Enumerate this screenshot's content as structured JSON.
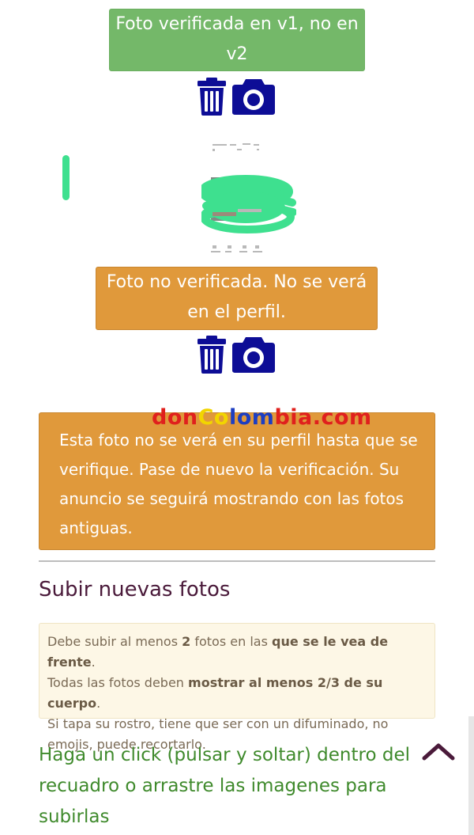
{
  "photo1": {
    "status_text": "Foto verificada en v1, no en v2"
  },
  "photo2": {
    "status_text": "Foto no verificada. No se verá en el perfil."
  },
  "watermark": {
    "part1": "don",
    "part2": "Co",
    "part3": "lom",
    "part4": "bia.com"
  },
  "alert": {
    "text": "Esta foto no se verá en su perfil hasta que se verifique. Pase de nuevo la verificación. Su anuncio se seguirá mostrando con las fotos antiguas."
  },
  "upload_section": {
    "title": "Subir nuevas fotos",
    "note": {
      "line1_a": "Debe subir al menos ",
      "line1_b": "2",
      "line1_c": " fotos en las ",
      "line1_d": "que se le vea de frente",
      "line1_e": ".",
      "line2_a": "Todas las fotos deben ",
      "line2_b": "mostrar al menos 2/3 de su cuerpo",
      "line2_c": ".",
      "line3": "Si tapa su rostro, tiene que ser con un difuminado, no emojis, puede recortarlo."
    },
    "dropzone_text": "Haga un click (pulsar y soltar) dentro del recuadro o arrastre las imagenes para subirlas"
  },
  "icons": {
    "delete": "trash-icon",
    "camera": "camera-icon",
    "scroll_top": "chevron-up-icon"
  },
  "colors": {
    "verified_green": "#74b869",
    "warning_orange": "#e0993b",
    "icon_blue": "#0d0d96",
    "title_plum": "#4a1a3a",
    "cta_green": "#3f8a2c"
  }
}
